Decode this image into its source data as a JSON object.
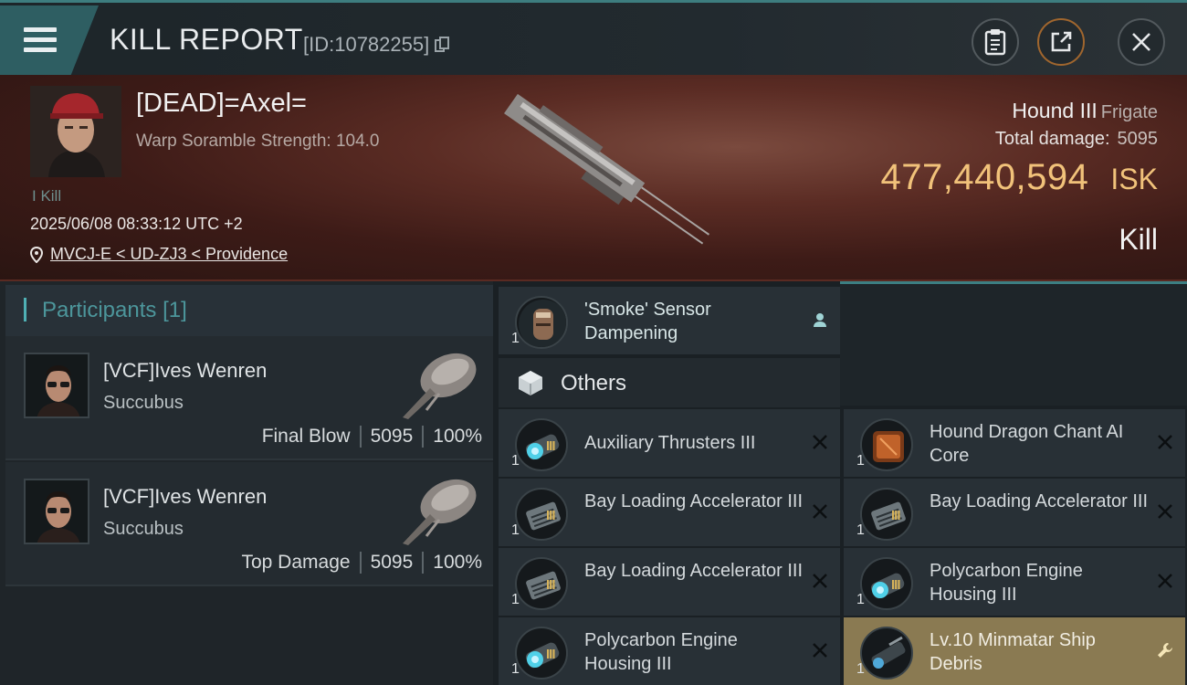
{
  "header": {
    "title": "KILL REPORT",
    "report_id": "[ID:10782255]"
  },
  "victim": {
    "name": "[DEAD]=Axel=",
    "scramble": "Warp Soramble Strength: 104.0",
    "tag": "I Kill",
    "datetime": "2025/06/08 08:33:12 UTC +2",
    "location": "MVCJ-E < UD-ZJ3 < Providence"
  },
  "ship": {
    "name": "Hound III",
    "class": "Frigate",
    "damage_label": "Total damage:",
    "damage_value": "5095",
    "isk_value": "477,440,594",
    "isk_unit": "ISK",
    "result": "Kill"
  },
  "participants": {
    "label": "Participants",
    "count": "[1]",
    "rows": [
      {
        "name": "[VCF]Ives Wenren",
        "ship": "Succubus",
        "role": "Final Blow",
        "damage": "5095",
        "percent": "100%"
      },
      {
        "name": "[VCF]Ives Wenren",
        "ship": "Succubus",
        "role": "Top Damage",
        "damage": "5095",
        "percent": "100%"
      }
    ]
  },
  "items": {
    "smoke": {
      "qty": "1",
      "name": "'Smoke' Sensor Dampening"
    },
    "others_label": "Others",
    "list": [
      {
        "qty": "1",
        "name": "Auxiliary Thrusters III"
      },
      {
        "qty": "1",
        "name": "Hound Dragon Chant AI Core"
      },
      {
        "qty": "1",
        "name": "Bay Loading Accelerator III"
      },
      {
        "qty": "1",
        "name": "Bay Loading Accelerator III"
      },
      {
        "qty": "1",
        "name": "Bay Loading Accelerator III"
      },
      {
        "qty": "1",
        "name": "Polycarbon Engine Housing III"
      },
      {
        "qty": "1",
        "name": "Polycarbon Engine Housing III"
      },
      {
        "qty": "1",
        "name": "Lv.10 Minmatar Ship Debris"
      }
    ]
  },
  "colors": {
    "accent": "#2e6b6f",
    "isk": "#f1c27a",
    "gold_item": "#8a7a52"
  }
}
